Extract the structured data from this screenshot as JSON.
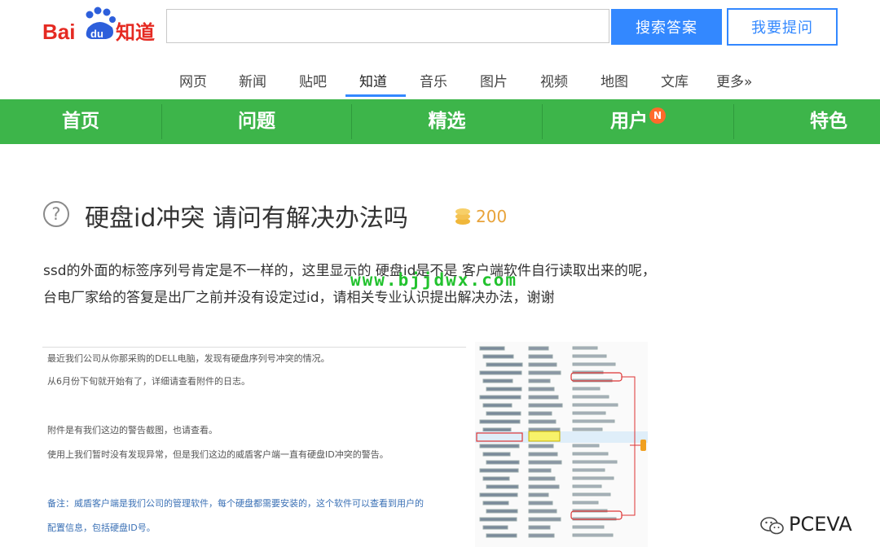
{
  "header": {
    "logo_text": "Bai du 知道",
    "search_placeholder": "",
    "search_button": "搜索答案",
    "ask_button": "我要提问"
  },
  "channels": [
    "网页",
    "新闻",
    "贴吧",
    "知道",
    "音乐",
    "图片",
    "视频",
    "地图",
    "文库",
    "更多»"
  ],
  "green_nav": {
    "items": [
      "首页",
      "问题",
      "精选",
      "用户",
      "特色"
    ],
    "badge": "N"
  },
  "question": {
    "icon": "question-circle-icon",
    "title": "硬盘id冲突 请问有解决办法吗",
    "reward": "200",
    "body": [
      "ssd的外面的标签序列号肯定是不一样的，这里显示的 硬盘id是不是 客户端软件自行读取出来的呢，",
      "台电厂家给的答复是出厂之前并没有设定过id，请相关专业认识提出解决办法，谢谢"
    ]
  },
  "watermark": "www.bjjdwx.com",
  "attachment": {
    "lines": [
      "最近我们公司从你那采购的DELL电脑，发现有硬盘序列号冲突的情况。",
      "从6月份下旬就开始有了，详细请查看附件的日志。",
      "附件是有我们这边的警告截图，也请查看。",
      "使用上我们暂时没有发现异常，但是我们这边的威盾客户端一直有硬盘ID冲突的警告。",
      "备注：威盾客户端是我们公司的管理软件，每个硬盘都需要安装的，这个软件可以查看到用户的",
      "配置信息，包括硬盘ID号。"
    ]
  },
  "brand": {
    "text": "PCEVA",
    "icon": "wechat-icon"
  },
  "colors": {
    "accent": "#3388ff",
    "green": "#3db54a",
    "reward": "#e8a33a",
    "watermark": "#22c22e"
  }
}
